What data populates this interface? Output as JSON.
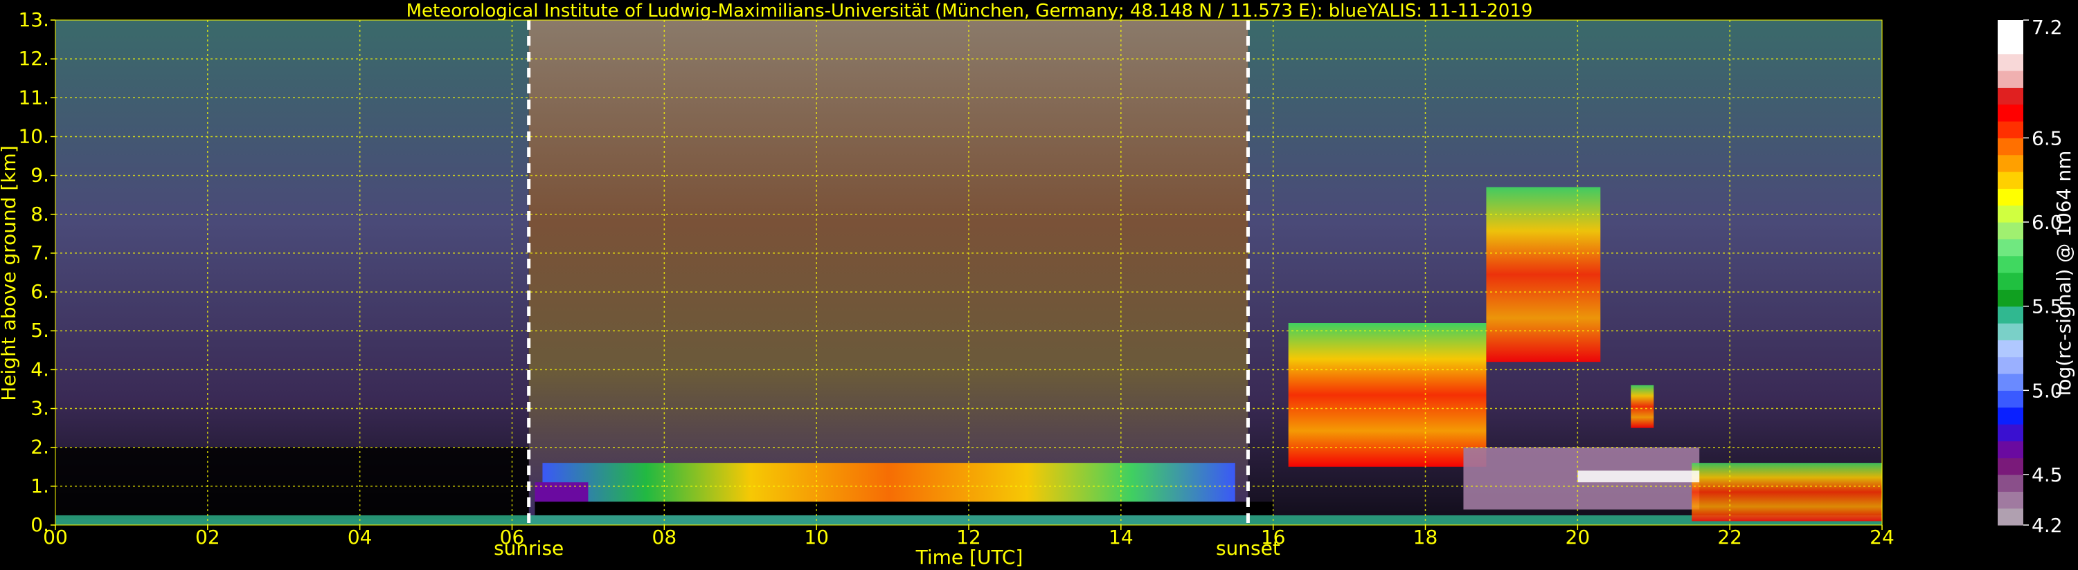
{
  "chart_data": {
    "type": "heatmap",
    "title": "Meteorological Institute of Ludwig-Maximilians-Universität (München, Germany; 48.148 N / 11.573 E):    blueYALIS: 11-11-2019",
    "xlabel": "Time [UTC]",
    "ylabel": "Height above ground [km]",
    "xlim": [
      0,
      24
    ],
    "ylim": [
      0,
      13
    ],
    "x_ticks": [
      "00",
      "02",
      "04",
      "06",
      "08",
      "10",
      "12",
      "14",
      "16",
      "18",
      "20",
      "22",
      "24"
    ],
    "x_tick_values": [
      0,
      2,
      4,
      6,
      8,
      10,
      12,
      14,
      16,
      18,
      20,
      22,
      24
    ],
    "y_ticks": [
      "0.",
      "1.",
      "2.",
      "3.",
      "4.",
      "5.",
      "6.",
      "7.",
      "8.",
      "9.",
      "10.",
      "11.",
      "12.",
      "13."
    ],
    "y_tick_values": [
      0,
      1,
      2,
      3,
      4,
      5,
      6,
      7,
      8,
      9,
      10,
      11,
      12,
      13
    ],
    "grid": true,
    "markers": [
      {
        "label": "sunrise",
        "time": 6.22
      },
      {
        "label": "sunset",
        "time": 15.67
      }
    ],
    "colorbar": {
      "label": "log(rc-signal) @ 1064 nm",
      "range": [
        4.2,
        7.2
      ],
      "ticks": [
        "4.2",
        "4.5",
        "5.0",
        "5.5",
        "6.0",
        "6.5",
        "7.2"
      ],
      "tick_values": [
        4.2,
        4.5,
        5.0,
        5.5,
        6.0,
        6.5,
        7.2
      ],
      "colors": [
        "#b0a0b0",
        "#a07aa0",
        "#8a4f8a",
        "#7a1a7a",
        "#6a0aa0",
        "#3a10d0",
        "#0a20ff",
        "#3a5aff",
        "#6a8aff",
        "#9ab0ff",
        "#b0c8ff",
        "#7ad0c8",
        "#30b890",
        "#10a020",
        "#20c040",
        "#40d860",
        "#70e880",
        "#a0f070",
        "#d0ff40",
        "#ffff00",
        "#ffd000",
        "#ffa000",
        "#ff7000",
        "#ff3000",
        "#ff0000",
        "#e02020",
        "#f0b0b0",
        "#f8d8d8",
        "#ffffff",
        "#ffffff"
      ]
    },
    "accent_color": "#ffff00"
  }
}
